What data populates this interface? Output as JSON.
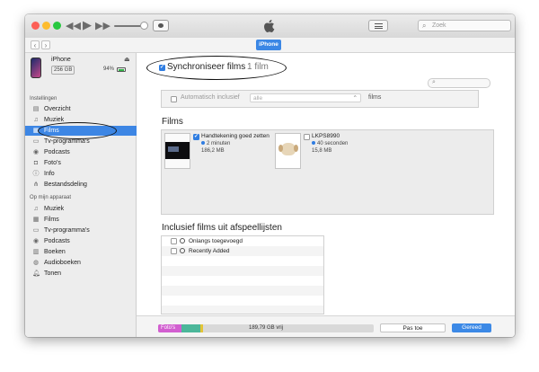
{
  "toolbar": {
    "search_placeholder": "Zoek",
    "device_label": "iPhone"
  },
  "device": {
    "name": "iPhone",
    "capacity": "256 GB",
    "battery": "94%"
  },
  "sidebar": {
    "settings_header": "Instellingen",
    "settings_items": [
      {
        "label": "Overzicht",
        "icon": "summary-icon"
      },
      {
        "label": "Muziek",
        "icon": "music-icon"
      },
      {
        "label": "Films",
        "icon": "film-icon",
        "selected": true
      },
      {
        "label": "Tv-programma's",
        "icon": "tv-icon"
      },
      {
        "label": "Podcasts",
        "icon": "podcast-icon"
      },
      {
        "label": "Foto's",
        "icon": "photos-icon"
      },
      {
        "label": "Info",
        "icon": "info-icon"
      },
      {
        "label": "Bestandsdeling",
        "icon": "file-sharing-icon"
      }
    ],
    "device_header": "Op mijn apparaat",
    "device_items": [
      {
        "label": "Muziek",
        "icon": "music-icon"
      },
      {
        "label": "Films",
        "icon": "film-icon"
      },
      {
        "label": "Tv-programma's",
        "icon": "tv-icon"
      },
      {
        "label": "Podcasts",
        "icon": "podcast-icon"
      },
      {
        "label": "Boeken",
        "icon": "books-icon"
      },
      {
        "label": "Audioboeken",
        "icon": "audiobooks-icon"
      },
      {
        "label": "Tonen",
        "icon": "tones-icon"
      }
    ]
  },
  "main": {
    "sync_label": "Synchroniseer films",
    "sync_count": "1 film",
    "auto_include_label": "Automatisch inclusief",
    "auto_include_value": "alle",
    "auto_include_suffix": "films",
    "films_header": "Films",
    "films": [
      {
        "title": "Handtekening goed zetten",
        "duration": "2 minuten",
        "size": "186,2 MB",
        "checked": true
      },
      {
        "title": "LKPS8990",
        "duration": "40 seconden",
        "size": "15,8 MB",
        "checked": false
      }
    ],
    "playlists_header": "Inclusief films uit afspeellijsten",
    "playlists": [
      {
        "name": "Onlangs toegevoegd"
      },
      {
        "name": "Recently Added"
      }
    ]
  },
  "bottom": {
    "photos_label": "Foto's",
    "free_label": "189,79 GB vrij",
    "apply_label": "Pas toe",
    "done_label": "Gereed"
  },
  "colors": {
    "accent": "#3c89e6",
    "photos": "#d25fd0",
    "apps": "#4cb79a",
    "other": "#e3c437",
    "free": "#d9d9d9"
  }
}
